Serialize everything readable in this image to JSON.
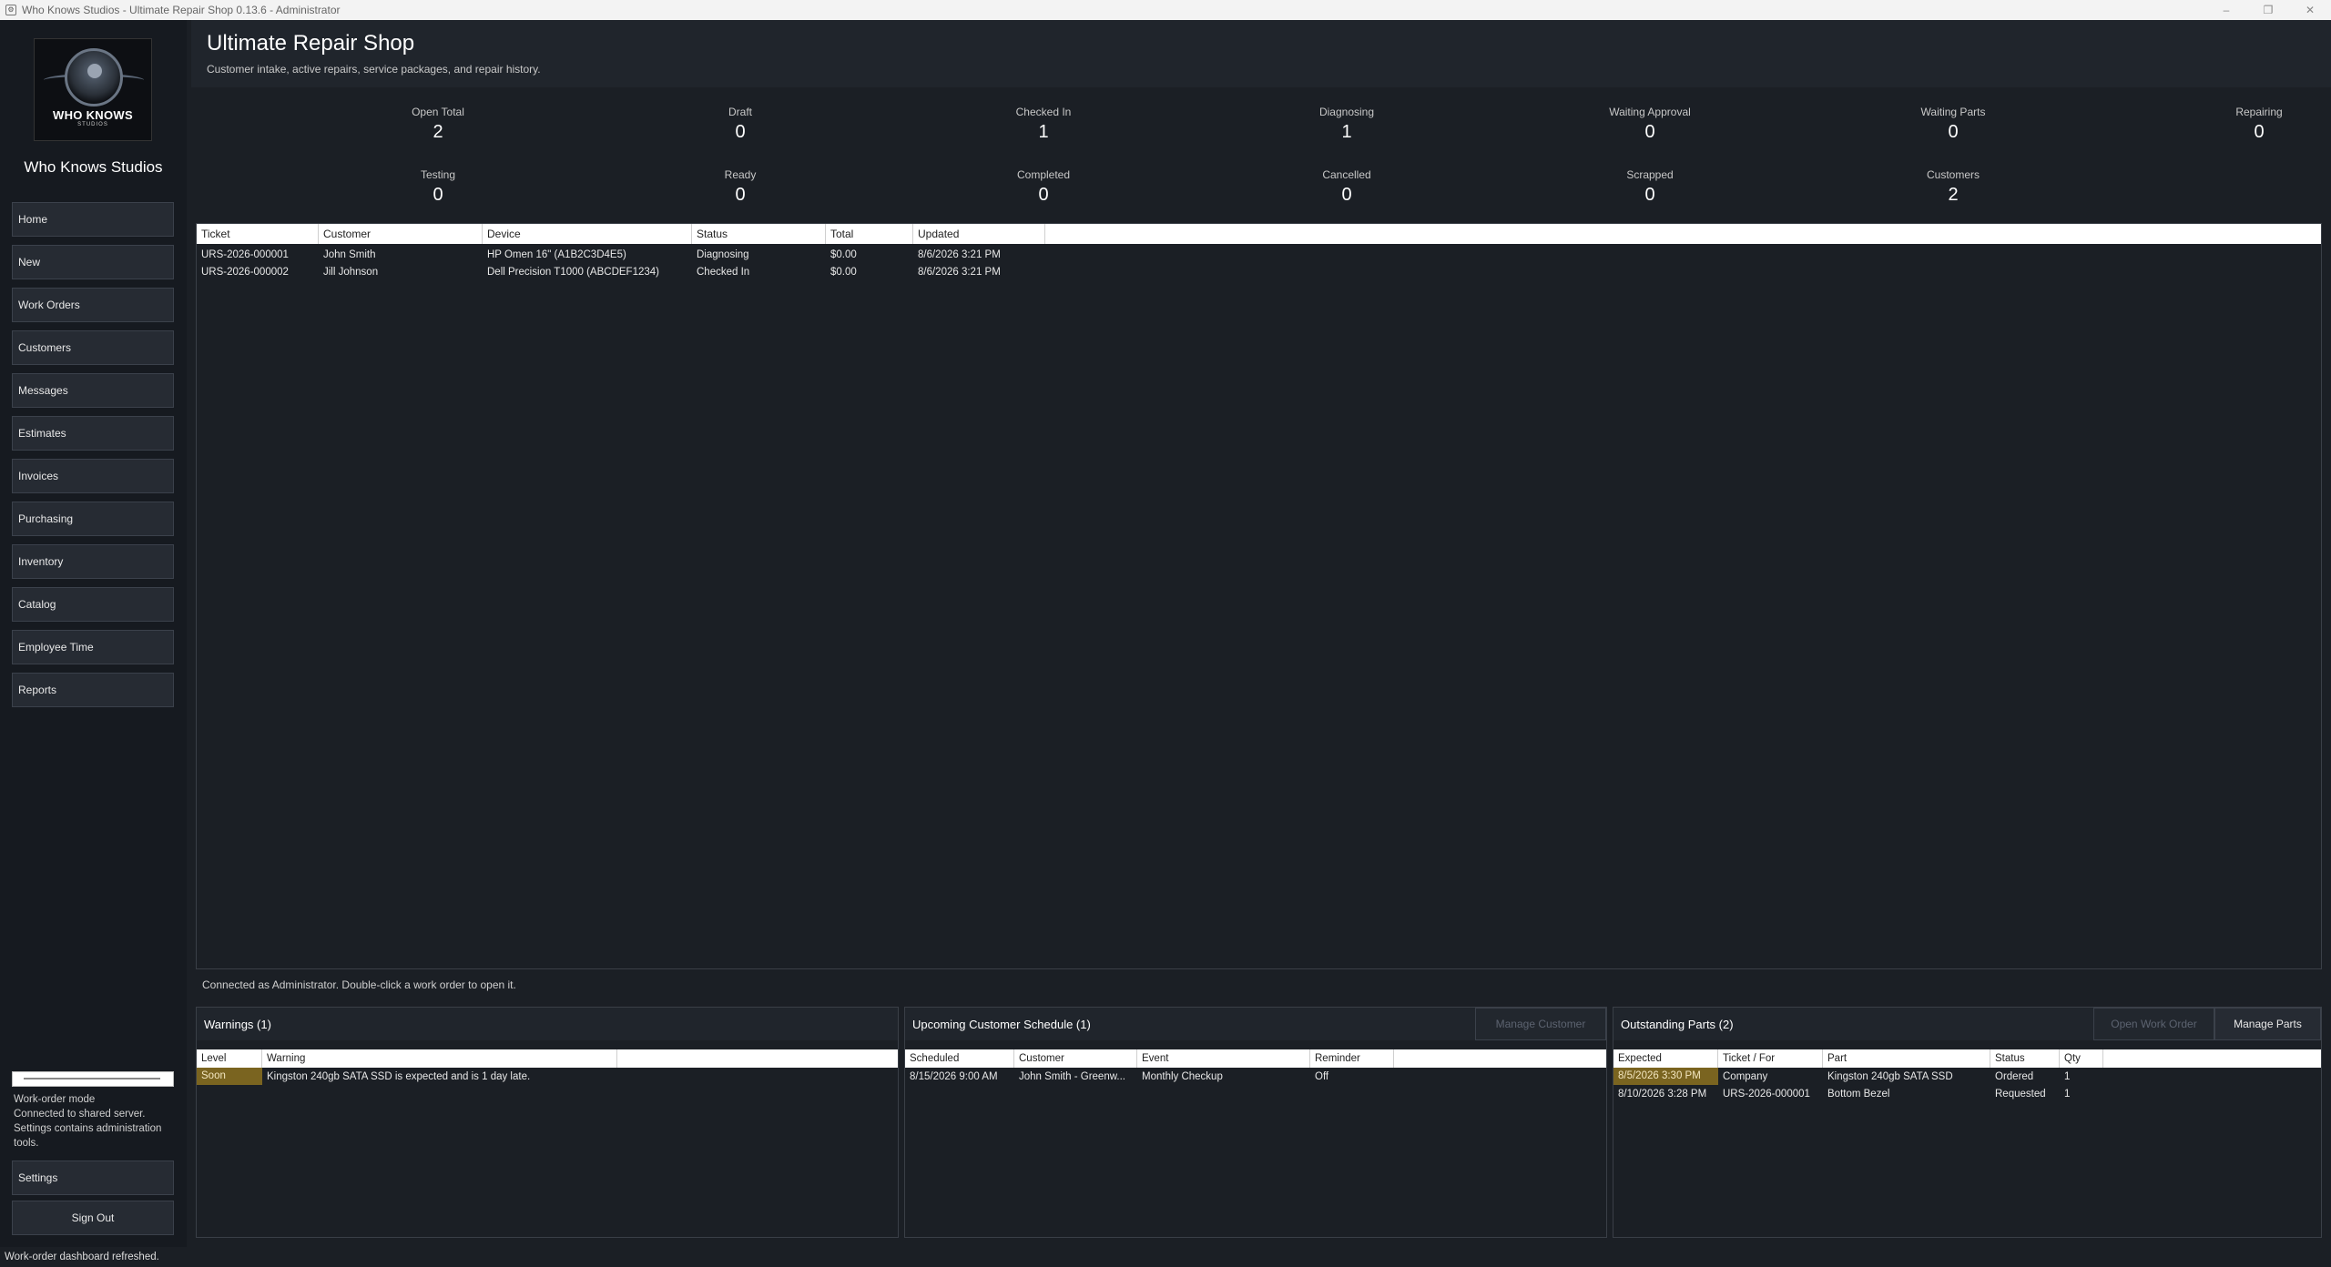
{
  "window": {
    "title": "Who Knows Studios - Ultimate Repair Shop 0.13.6 - Administrator"
  },
  "sidebar": {
    "logo_text": "WHO KNOWS",
    "logo_sub": "STUDIOS",
    "company": "Who Knows Studios",
    "nav": [
      "Home",
      "New",
      "Work Orders",
      "Customers",
      "Messages",
      "Estimates",
      "Invoices",
      "Purchasing",
      "Inventory",
      "Catalog",
      "Employee Time",
      "Reports"
    ],
    "info": [
      "Work-order mode",
      "Connected to shared server.",
      "Settings contains administration tools."
    ],
    "settings_label": "Settings",
    "signout_label": "Sign Out"
  },
  "header": {
    "title": "Ultimate Repair Shop",
    "subtitle": "Customer intake, active repairs, service packages, and repair history."
  },
  "stats": [
    {
      "label": "Open Total",
      "value": "2"
    },
    {
      "label": "Draft",
      "value": "0"
    },
    {
      "label": "Checked In",
      "value": "1"
    },
    {
      "label": "Diagnosing",
      "value": "1"
    },
    {
      "label": "Waiting Approval",
      "value": "0"
    },
    {
      "label": "Waiting Parts",
      "value": "0"
    },
    {
      "label": "Repairing",
      "value": "0"
    },
    {
      "label": "Testing",
      "value": "0"
    },
    {
      "label": "Ready",
      "value": "0"
    },
    {
      "label": "Completed",
      "value": "0"
    },
    {
      "label": "Cancelled",
      "value": "0"
    },
    {
      "label": "Scrapped",
      "value": "0"
    },
    {
      "label": "Customers",
      "value": "2"
    }
  ],
  "work_orders": {
    "columns": [
      "Ticket",
      "Customer",
      "Device",
      "Status",
      "Total",
      "Updated"
    ],
    "rows": [
      [
        "URS-2026-000001",
        "John Smith",
        "HP Omen 16\" (A1B2C3D4E5)",
        "Diagnosing",
        "$0.00",
        "8/6/2026 3:21 PM"
      ],
      [
        "URS-2026-000002",
        "Jill Johnson",
        "Dell Precision T1000 (ABCDEF1234)",
        "Checked In",
        "$0.00",
        "8/6/2026 3:21 PM"
      ]
    ]
  },
  "connected_text": "Connected as Administrator. Double-click a work order to open it.",
  "warnings": {
    "title": "Warnings (1)",
    "columns": [
      "Level",
      "Warning"
    ],
    "rows": [
      [
        "Soon",
        "Kingston 240gb SATA SSD is expected and is 1 day late."
      ]
    ]
  },
  "schedule": {
    "title": "Upcoming Customer Schedule (1)",
    "button": "Manage Customer",
    "columns": [
      "Scheduled",
      "Customer",
      "Event",
      "Reminder"
    ],
    "rows": [
      [
        "8/15/2026 9:00 AM",
        "John Smith - Greenw...",
        "Monthly Checkup",
        "Off"
      ]
    ]
  },
  "parts": {
    "title": "Outstanding Parts (2)",
    "button_open": "Open Work Order",
    "button_manage": "Manage Parts",
    "columns": [
      "Expected",
      "Ticket / For",
      "Part",
      "Status",
      "Qty"
    ],
    "rows": [
      [
        "8/5/2026 3:30 PM",
        "Company",
        "Kingston 240gb SATA SSD",
        "Ordered",
        "1"
      ],
      [
        "8/10/2026 3:28 PM",
        "URS-2026-000001",
        "Bottom Bezel",
        "Requested",
        "1"
      ]
    ]
  },
  "statusbar": "Work-order dashboard refreshed.",
  "colors": {
    "background": "#1b1f25",
    "warning_highlight": "#7a6420"
  }
}
